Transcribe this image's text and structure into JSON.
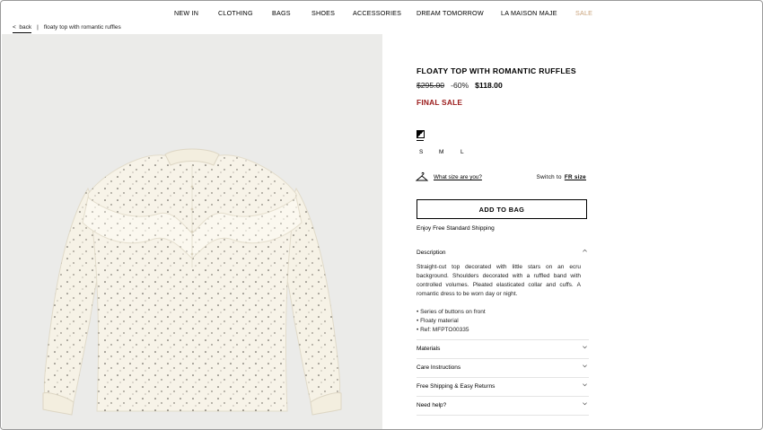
{
  "nav": {
    "items": [
      "NEW IN",
      "CLOTHING",
      "BAGS",
      "SHOES",
      "ACCESSORIES",
      "DREAM TOMORROW",
      "LA MAISON MAJE",
      "SALE"
    ],
    "sale_color": "#c9a27a"
  },
  "breadcrumb": {
    "back_arrow": "<",
    "back": "back",
    "separator": "|",
    "current": "floaty top with romantic ruffles"
  },
  "product": {
    "title": "FLOATY TOP WITH ROMANTIC RUFFLES",
    "old_price": "$295.00",
    "discount": "-60%",
    "new_price": "$118.00",
    "final_sale": "FINAL SALE",
    "final_sale_color": "#9a1a1a",
    "image_icon": "blouse-photo",
    "swatch_icon": "color-swatch-icon",
    "sizes": [
      "S",
      "M",
      "L"
    ]
  },
  "size_help": {
    "icon": "hanger-icon",
    "what_size": "What size are you?",
    "switch_to": "Switch to",
    "size_system": "FR size"
  },
  "cart": {
    "add_to_bag": "ADD TO BAG",
    "shipping_note": "Enjoy Free Standard Shipping"
  },
  "description": {
    "heading": "Description",
    "state": "expanded",
    "text": "Straight-cut top decorated with little stars on an ecru background. Shoulders decorated with a ruffled band with controlled volumes. Pleated elasticated collar and cuffs. A romantic dress to be worn day or night.",
    "bullets": [
      "• Series of buttons on front",
      "• Floaty material",
      "• Ref: MFPTO00335"
    ]
  },
  "accordions": [
    "Materials",
    "Care Instructions",
    "Free Shipping & Easy Returns",
    "Need help?"
  ]
}
